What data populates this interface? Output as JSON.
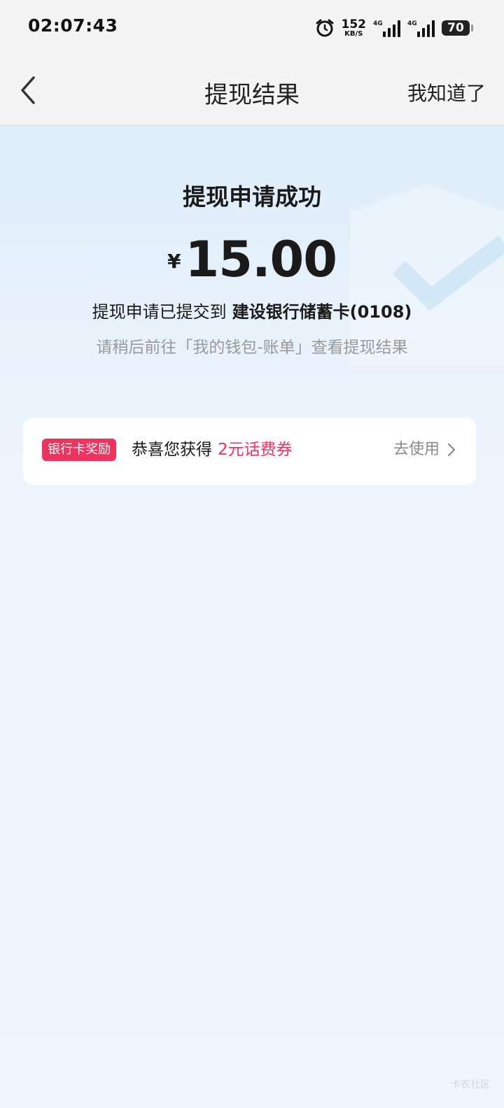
{
  "status_bar": {
    "time": "02:07:43",
    "net_speed_value": "152",
    "net_speed_unit": "KB/S",
    "sim1_tag": "4G",
    "sim2_tag": "4G",
    "battery": "70"
  },
  "nav": {
    "title": "提现结果",
    "action_label": "我知道了"
  },
  "result": {
    "title": "提现申请成功",
    "currency": "¥",
    "amount": "15.00",
    "submitted_prefix": "提现申请已提交到",
    "bank_card": "建设银行储蓄卡(0108)",
    "hint": "请稍后前往「我的钱包-账单」查看提现结果"
  },
  "reward": {
    "badge": "银行卡奖励",
    "text_prefix": "恭喜您获得",
    "coupon": "2元话费券",
    "action_label": "去使用"
  },
  "watermark": "卡农社区",
  "colors": {
    "accent": "#f0325f",
    "hint_gray": "#9a9a9a"
  }
}
